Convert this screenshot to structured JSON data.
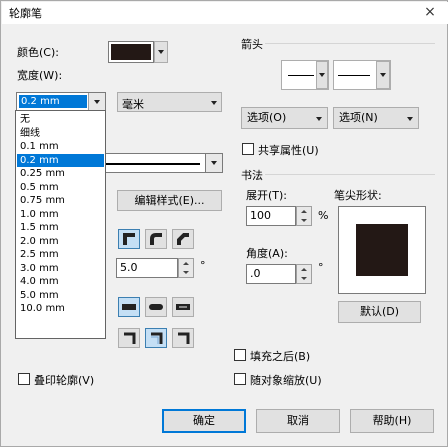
{
  "window": {
    "title": "轮廓笔",
    "close_glyph": "×"
  },
  "left": {
    "color_label": "颜色(C):",
    "color_value": "#231815",
    "width_label": "宽度(W):",
    "width_value": "0.2 mm",
    "unit_value": "毫米",
    "width_options": [
      "无",
      "细线",
      "0.1 mm",
      "0.2 mm",
      "0.25 mm",
      "0.5 mm",
      "0.75 mm",
      "1.0 mm",
      "1.5 mm",
      "2.0 mm",
      "2.5 mm",
      "3.0 mm",
      "4.0 mm",
      "5.0 mm",
      "10.0 mm"
    ],
    "selected_option_index": 3,
    "edit_style_button": "编辑样式(E)...",
    "miter_value": "5.0",
    "degree_symbol": "°",
    "overprint_label": "叠印轮廓(V)"
  },
  "right": {
    "arrows_title": "箭头",
    "options_left_button": "选项(O)",
    "options_right_button": "选项(N)",
    "share_attr_label": "共享属性(U)",
    "calligraphy_title": "书法",
    "stretch_label": "展开(T):",
    "stretch_value": "100",
    "percent_symbol": "%",
    "nib_shape_label": "笔尖形状:",
    "angle_label": "角度(A):",
    "angle_value": ".0",
    "degree_symbol": "°",
    "default_button": "默认(D)",
    "fill_behind_label": "填充之后(B)",
    "scale_with_label": "随对象缩放(U)"
  },
  "footer": {
    "ok_button": "确定",
    "cancel_button": "取消",
    "help_button": "帮助(H)"
  },
  "colors": {
    "swatch": "#231815",
    "selection": "#0078d7"
  }
}
